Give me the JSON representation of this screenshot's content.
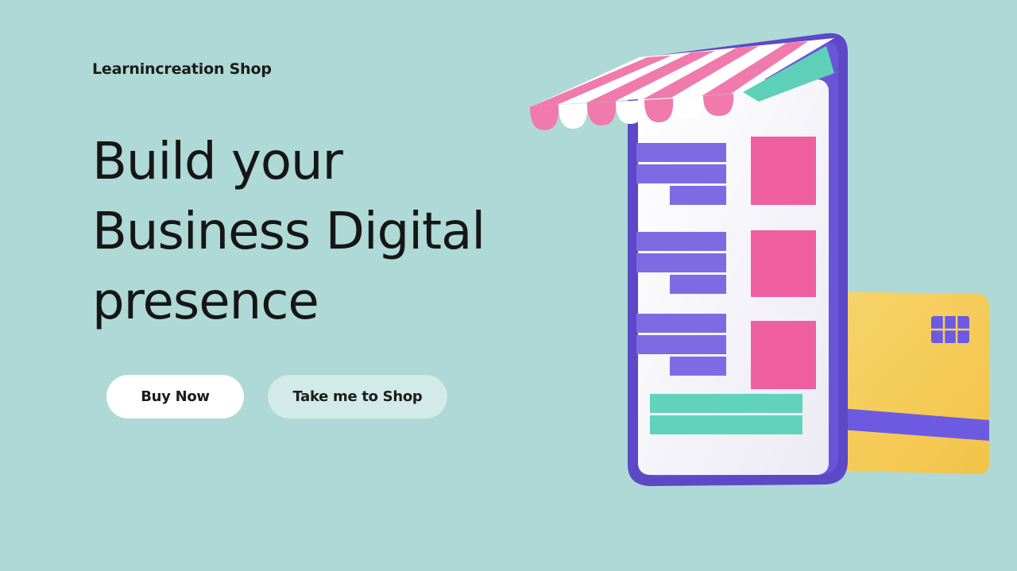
{
  "brand": {
    "name": "Learnincreation Shop"
  },
  "hero": {
    "headline_lines": [
      "Build your",
      "Business Digital",
      "presence"
    ]
  },
  "actions": {
    "buy_label": "Buy Now",
    "shop_label": "Take me to Shop"
  },
  "illustration": {
    "icon": "online-store-phone-illustration",
    "colors": {
      "background": "#aed9d6",
      "phone_frame": "#6a55d8",
      "awning_pink": "#f07aac",
      "tiles_pink": "#ef5f9f",
      "bars_purple": "#7e6be4",
      "bars_teal": "#61d3bd",
      "card_yellow": "#f6cf5e"
    }
  }
}
